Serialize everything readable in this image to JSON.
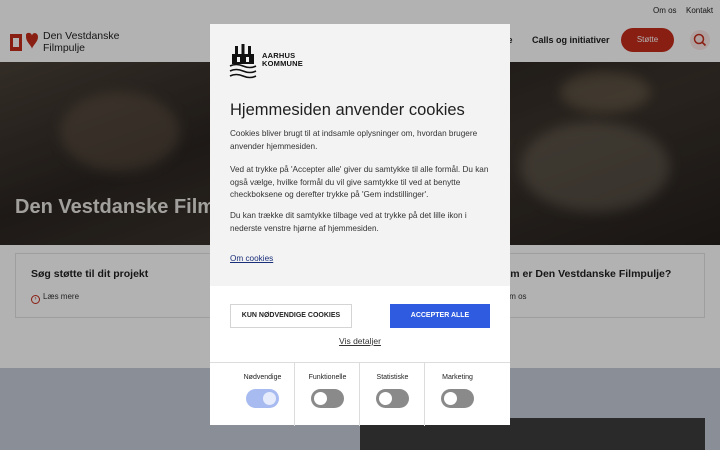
{
  "topbar": {
    "links": [
      "Om os",
      "Kontakt"
    ]
  },
  "header": {
    "logo_line1": "Den Vestdanske",
    "logo_line2": "Filmpulje",
    "nav_partial": "je",
    "nav_calls": "Calls og initiativer",
    "support_label": "Støtte"
  },
  "hero": {
    "title": "Den Vestdanske Filmpulje"
  },
  "cards": [
    {
      "title": "Søg støtte til dit projekt",
      "link": "Læs mere"
    },
    {
      "title": "Hvem er Den Vestdanske Filmpulje?",
      "link": "Om os"
    }
  ],
  "dialog": {
    "brand_line1": "AARHUS",
    "brand_line2": "KOMMUNE",
    "title": "Hjemmesiden anvender cookies",
    "paragraphs": [
      "Cookies bliver brugt til at indsamle oplysninger om, hvordan brugere anvender hjemmesiden.",
      "Ved at trykke på 'Accepter alle' giver du samtykke til alle formål. Du kan også vælge, hvilke formål du vil give samtykke til ved at benytte checkboksene og derefter trykke på 'Gem indstillinger'.",
      "Du kan trække dit samtykke tilbage ved at trykke på det lille ikon i nederste venstre hjørne af hjemmesiden."
    ],
    "about_link": "Om cookies",
    "btn_necessary": "KUN NØDVENDIGE COOKIES",
    "btn_accept": "ACCEPTER ALLE",
    "details_link": "Vis detaljer",
    "categories": [
      {
        "label": "Nødvendige",
        "enabled": true
      },
      {
        "label": "Funktionelle",
        "enabled": false
      },
      {
        "label": "Statistiske",
        "enabled": false
      },
      {
        "label": "Marketing",
        "enabled": false
      }
    ]
  },
  "colors": {
    "brand_red": "#c52b1a",
    "accept_blue": "#2f5be0",
    "link_blue": "#1a2f7a"
  }
}
